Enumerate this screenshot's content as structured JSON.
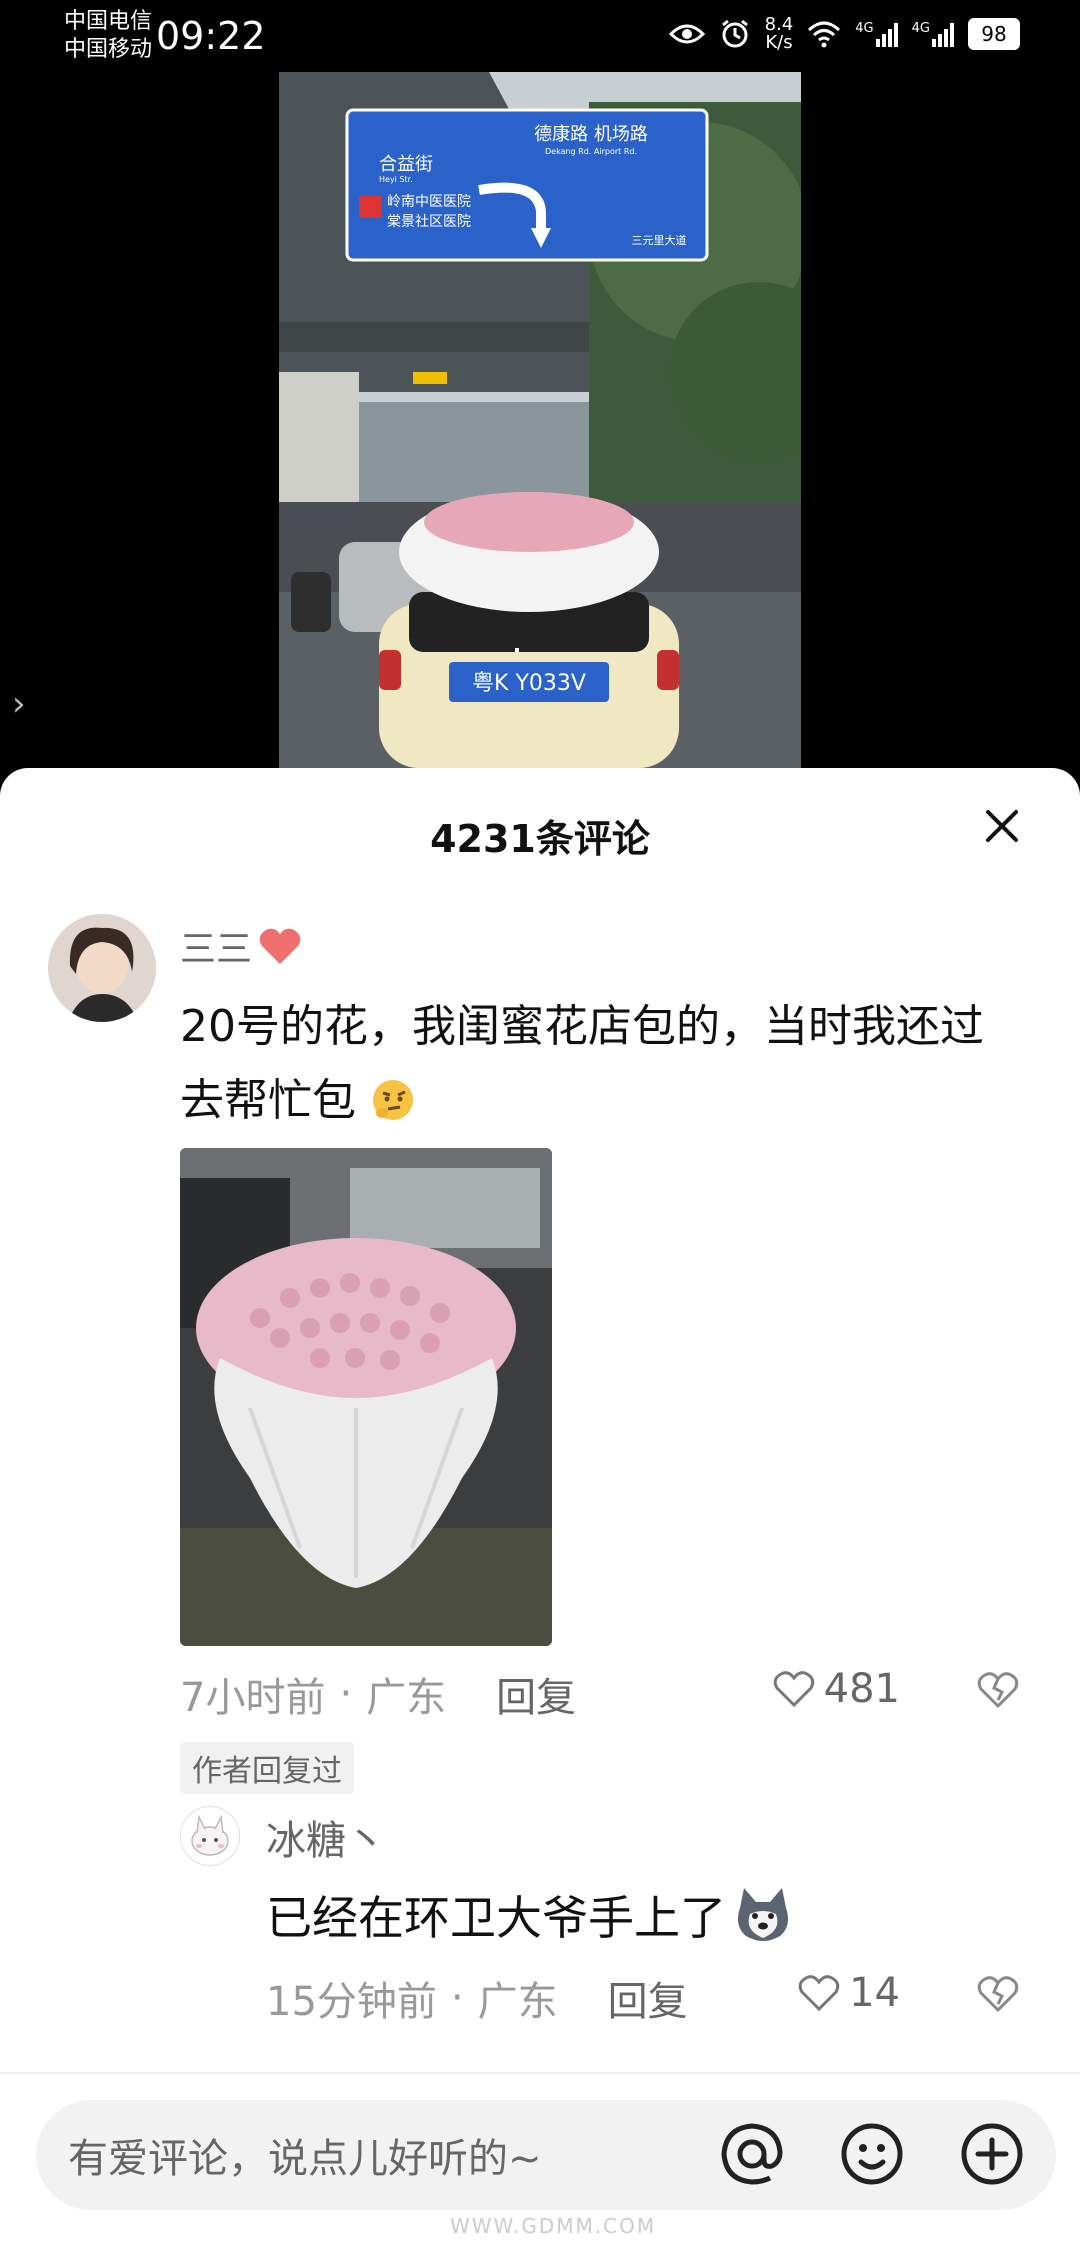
{
  "status_bar": {
    "carrier_1": "中国电信",
    "carrier_2": "中国移动",
    "time": "09:22",
    "net_speed_value": "8.4",
    "net_speed_unit": "K/s",
    "signal_label_1": "4G",
    "signal_label_2": "4G",
    "battery": "98"
  },
  "video": {
    "sign_line_1": "德康路 机场路",
    "sign_line_1_en": "Dekang Rd.   Airport Rd.",
    "sign_line_2": "合益街",
    "sign_line_2_en": "Heyi Str.",
    "sign_hospital_1": "岭南中医医院",
    "sign_hospital_2": "棠景社区医院",
    "sign_road": "三元里大道",
    "plate": "粤K Y033V"
  },
  "comments_sheet": {
    "title": "4231条评论",
    "comment": {
      "username": "三三",
      "text": "20号的花，我闺蜜花店包的，当时我还过去帮忙包",
      "time": "7小时前",
      "location": "广东",
      "reply_label": "回复",
      "likes": "481",
      "author_badge": "作者回复过"
    },
    "reply": {
      "username": "冰糖丶",
      "text": "已经在环卫大爷手上了",
      "time": "15分钟前",
      "location": "广东",
      "reply_label": "回复",
      "likes": "14"
    },
    "input": {
      "placeholder": "有爱评论，说点儿好听的~"
    },
    "watermark": "WWW.GDMM.COM"
  },
  "colors": {
    "heart": "#ef6f6f",
    "sign_blue": "#2a62c9"
  }
}
